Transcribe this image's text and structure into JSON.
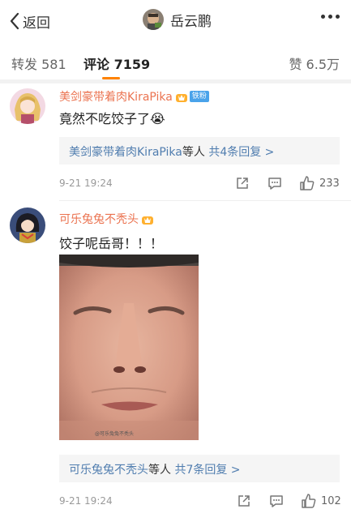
{
  "header": {
    "back_label": "返回",
    "profile_name": "岳云鹏"
  },
  "tabs": {
    "repost_label": "转发",
    "repost_count": "581",
    "comments_label": "评论",
    "comments_count": "7159",
    "likes_label": "赞",
    "likes_count": "6.5万"
  },
  "comments": [
    {
      "username": "美剑豪带着肉KiraPika",
      "badge": "铁粉",
      "text": "竟然不吃饺子了",
      "emoji": "😭",
      "replies_users": "美剑豪带着肉KiraPika",
      "replies_suffix": "等人",
      "replies_count": "共4条回复 >",
      "time": "9-21 19:24",
      "like_count": "233"
    },
    {
      "username": "可乐兔兔不秃头",
      "text": "饺子呢岳哥！！！",
      "photo_watermark": "@可乐兔兔不秃头",
      "replies_users": "可乐兔兔不秃头",
      "replies_suffix": "等人",
      "replies_count": "共7条回复 >",
      "time": "9-21 19:24",
      "like_count": "102"
    }
  ],
  "colors": {
    "username": "#eb7350",
    "link": "#507daf",
    "accent": "#ff8200"
  }
}
